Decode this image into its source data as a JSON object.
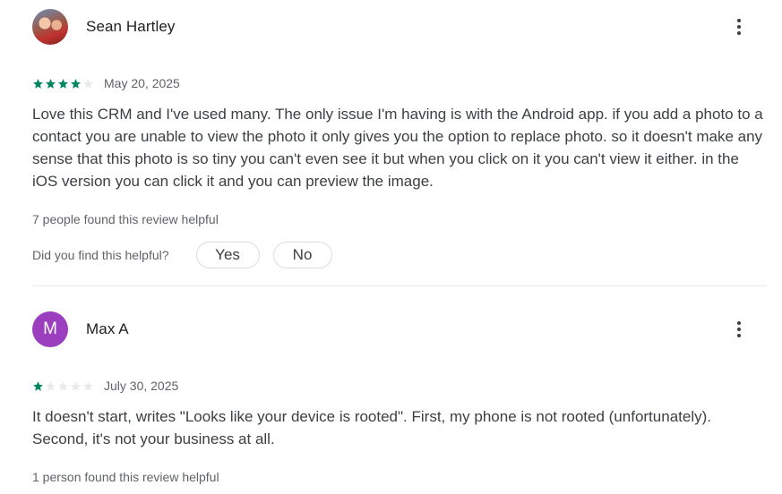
{
  "reviews": [
    {
      "author": "Sean Hartley",
      "avatar_type": "photo",
      "rating": 4,
      "max_rating": 5,
      "date": "May 20, 2025",
      "text": "Love this CRM and I've used many. The only issue I'm having is with the Android app. if you add a photo to a contact you are unable to view the photo it only gives you the option to replace photo. so it doesn't make any sense that this photo is so tiny you can't even see it but when you click on it you can't view it either. in the iOS version you can click it and you can preview the image.",
      "helpful_count_text": "7 people found this review helpful",
      "helpful_question": "Did you find this helpful?",
      "yes_label": "Yes",
      "no_label": "No"
    },
    {
      "author": "Max A",
      "avatar_letter": "M",
      "avatar_color": "#9c3fbf",
      "rating": 1,
      "max_rating": 5,
      "date": "July 30, 2025",
      "text": "It doesn't start, writes \"Looks like your device is rooted\". First, my phone is not rooted (unfortunately). Second, it's not your business at all.",
      "helpful_count_text": "1 person found this review helpful"
    }
  ],
  "colors": {
    "star_filled": "#01875f",
    "star_empty": "#e8eaed"
  },
  "icons": {
    "more": "more-vert-icon",
    "star": "star-icon"
  }
}
